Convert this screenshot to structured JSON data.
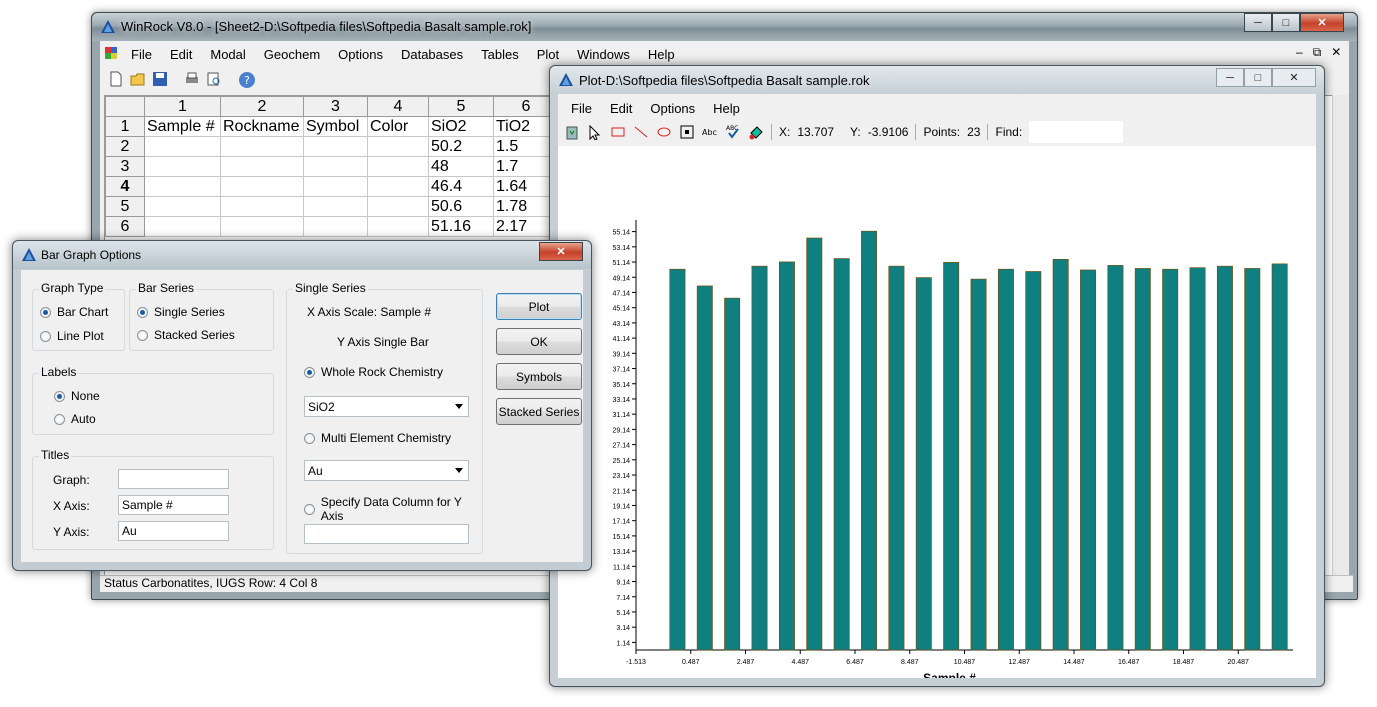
{
  "main_window": {
    "title": "WinRock V8.0 - [Sheet2-D:\\Softpedia files\\Softpedia Basalt sample.rok]",
    "menu": [
      "File",
      "Edit",
      "Modal",
      "Geochem",
      "Options",
      "Databases",
      "Tables",
      "Plot",
      "Windows",
      "Help"
    ],
    "toolbar_icons": [
      "new-file-icon",
      "open-folder-icon",
      "save-icon",
      "print-icon",
      "print-preview-icon",
      "help-icon"
    ],
    "grid": {
      "col_headers": [
        "1",
        "2",
        "3",
        "4",
        "5",
        "6"
      ],
      "rows": [
        {
          "num": "1",
          "cells": [
            "Sample #",
            "Rockname",
            "Symbol",
            "Color",
            "SiO2",
            "TiO2"
          ]
        },
        {
          "num": "2",
          "cells": [
            "",
            "",
            "",
            "",
            "50.2",
            "1.5"
          ]
        },
        {
          "num": "3",
          "cells": [
            "",
            "",
            "",
            "",
            "48",
            "1.7"
          ]
        },
        {
          "num": "4",
          "cells": [
            "",
            "",
            "",
            "",
            "46.4",
            "1.64"
          ]
        },
        {
          "num": "5",
          "cells": [
            "",
            "",
            "",
            "",
            "50.6",
            "1.78"
          ]
        },
        {
          "num": "6",
          "cells": [
            "",
            "",
            "",
            "",
            "51.16",
            "2.17"
          ]
        }
      ]
    },
    "status_bar": "Status  Carbonatites, IUGS  Row:  4  Col  8"
  },
  "dialog": {
    "title": "Bar Graph Options",
    "graph_type": {
      "title": "Graph Type",
      "options": [
        "Bar Chart",
        "Line Plot"
      ],
      "selected": "Bar Chart"
    },
    "bar_series": {
      "title": "Bar Series",
      "options": [
        "Single Series",
        "Stacked Series"
      ],
      "selected": "Single Series"
    },
    "labels": {
      "title": "Labels",
      "options": [
        "None",
        "Auto"
      ],
      "selected": "None"
    },
    "titles": {
      "title": "Titles",
      "graph_label": "Graph:",
      "graph_value": "",
      "xaxis_label": "X Axis:",
      "xaxis_value": "Sample #",
      "yaxis_label": "Y Axis:",
      "yaxis_value": "Au"
    },
    "single_series": {
      "title": "Single Series",
      "x_axis_scale": "X Axis Scale: Sample #",
      "y_axis_single_bar": "Y Axis Single Bar",
      "whole_rock_label": "Whole Rock Chemistry",
      "whole_rock_value": "SiO2",
      "multi_element_label": "Multi Element Chemistry",
      "multi_element_value": "Au",
      "specify_column_label": "Specify Data Column for Y Axis",
      "specify_column_value": "",
      "selected": "Whole Rock Chemistry"
    },
    "buttons": [
      "Plot",
      "OK",
      "Symbols",
      "Stacked Series"
    ]
  },
  "plot_window": {
    "title": "Plot-D:\\Softpedia files\\Softpedia Basalt sample.rok",
    "menu": [
      "File",
      "Edit",
      "Options",
      "Help"
    ],
    "toolbar_icons": [
      "recycle-icon",
      "pointer-icon",
      "rectangle-icon",
      "line-icon",
      "ellipse-icon",
      "frame-icon",
      "text-abc-icon",
      "spell-check-icon",
      "color-fill-icon"
    ],
    "x_label": "X:",
    "x_value": "13.707",
    "y_label": "Y:",
    "y_value": "-3.9106",
    "points_label": "Points:",
    "points_value": "23",
    "find_label": "Find:",
    "find_value": ""
  },
  "chart_data": {
    "type": "bar",
    "xlabel": "Sample #",
    "ylabel": "",
    "bar_color": "#0f7f7f",
    "ylim": [
      0.14,
      56.14
    ],
    "xlim": [
      -1.513,
      22.487
    ],
    "y_ticks": [
      "55.14",
      "53.14",
      "51.14",
      "49.14",
      "47.14",
      "45.14",
      "43.14",
      "41.14",
      "39.14",
      "37.14",
      "35.14",
      "33.14",
      "31.14",
      "29.14",
      "27.14",
      "25.14",
      "23.14",
      "21.14",
      "19.14",
      "17.14",
      "15.14",
      "13.14",
      "11.14",
      "9.14",
      "7.14",
      "5.14",
      "3.14",
      "1.14"
    ],
    "x_ticks": [
      "-1.513",
      "0.487",
      "2.487",
      "4.487",
      "6.487",
      "8.487",
      "10.487",
      "12.487",
      "14.487",
      "16.487",
      "18.487",
      "20.487"
    ],
    "x": [
      0,
      1,
      2,
      3,
      4,
      5,
      6,
      7,
      8,
      9,
      10,
      11,
      12,
      13,
      14,
      15,
      16,
      17,
      18,
      19,
      20,
      21,
      22
    ],
    "values": [
      50.2,
      48,
      46.4,
      50.6,
      51.16,
      54.3,
      51.6,
      55.2,
      50.6,
      49.1,
      51.1,
      48.9,
      50.2,
      49.9,
      51.5,
      50.1,
      50.7,
      50.3,
      50.2,
      50.4,
      50.6,
      50.3,
      50.9
    ]
  }
}
